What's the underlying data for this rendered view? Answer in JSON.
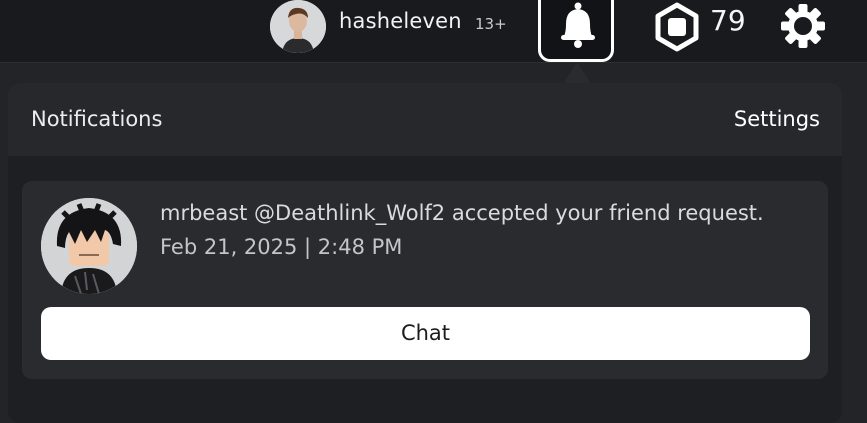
{
  "header": {
    "username": "hasheleven",
    "age_badge": "13+",
    "robux_count": "79",
    "icons": {
      "bell": "bell-icon",
      "robux": "robux-icon",
      "settings": "gear-icon"
    }
  },
  "notifications": {
    "title": "Notifications",
    "settings_label": "Settings",
    "items": [
      {
        "message": "mrbeast @Deathlink_Wolf2 accepted your friend request.",
        "timestamp": "Feb 21, 2025 | 2:48 PM",
        "action_label": "Chat"
      }
    ]
  },
  "colors": {
    "topbar_bg": "#191a1d",
    "panel_bg": "#1e1f22",
    "card_bg": "#2a2b2f",
    "button_bg": "#ffffff"
  }
}
